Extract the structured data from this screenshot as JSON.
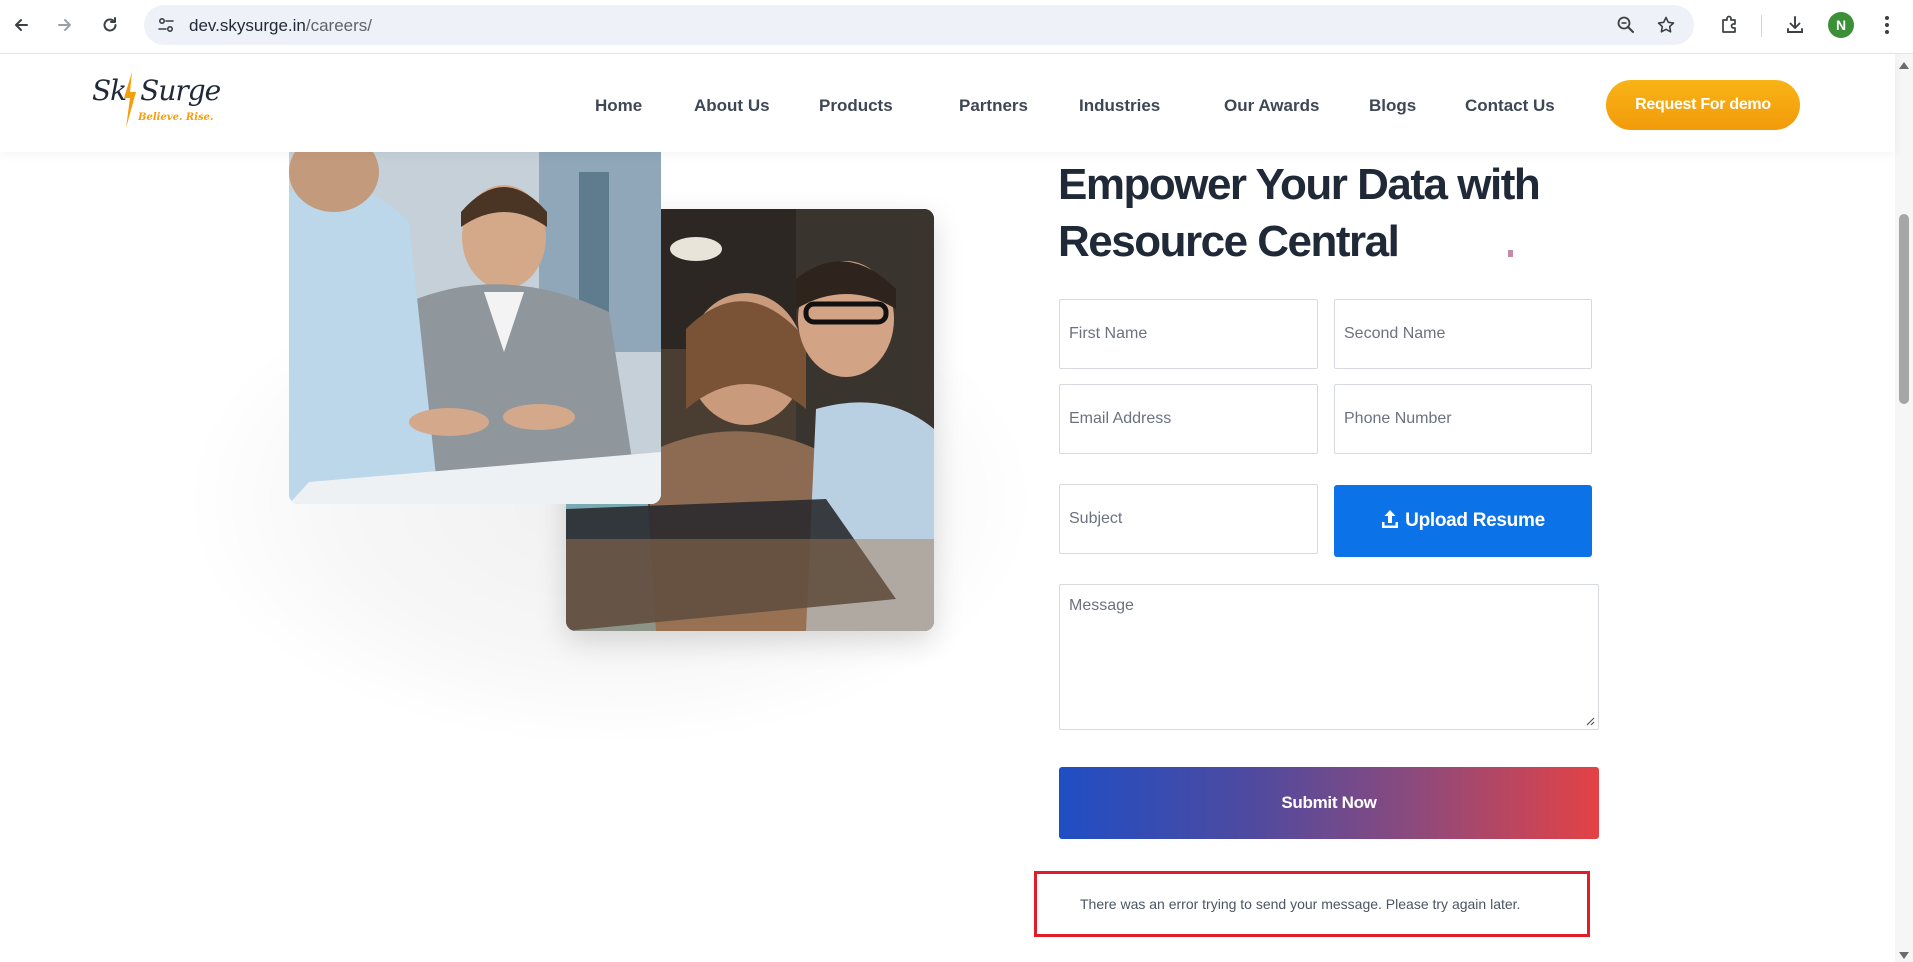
{
  "browser": {
    "url_host": "dev.skysurge.in",
    "url_path": "/careers/",
    "profile_initial": "N",
    "icons": [
      "back-arrow-icon",
      "forward-arrow-icon",
      "reload-icon",
      "site-info-icon",
      "zoom-icon",
      "bookmark-star-icon",
      "extensions-icon",
      "download-icon",
      "menu-dots-icon"
    ]
  },
  "site": {
    "logo": {
      "text": "Sky Surge",
      "tagline": "Believe. Rise."
    },
    "nav": [
      {
        "label": "Home"
      },
      {
        "label": "About Us"
      },
      {
        "label": "Products"
      },
      {
        "label": "Partners"
      },
      {
        "label": "Industries"
      },
      {
        "label": "Our Awards"
      },
      {
        "label": "Blogs"
      },
      {
        "label": "Contact Us"
      }
    ],
    "cta_label": "Request For demo",
    "colors": {
      "cta": "#f4a20e",
      "upload": "#0b72e7",
      "submit_start": "#1f4ec4",
      "submit_end": "#e44245",
      "error_border": "#e11d2a"
    }
  },
  "form": {
    "heading_line1": "Empower Your Data with",
    "heading_line2": "Resource Central",
    "first_name_placeholder": "First Name",
    "second_name_placeholder": "Second Name",
    "email_placeholder": "Email Address",
    "phone_placeholder": "Phone Number",
    "subject_placeholder": "Subject",
    "upload_label": "Upload Resume",
    "message_placeholder": "Message",
    "submit_label": "Submit Now",
    "error_message": "There was an error trying to send your message. Please try again later."
  }
}
